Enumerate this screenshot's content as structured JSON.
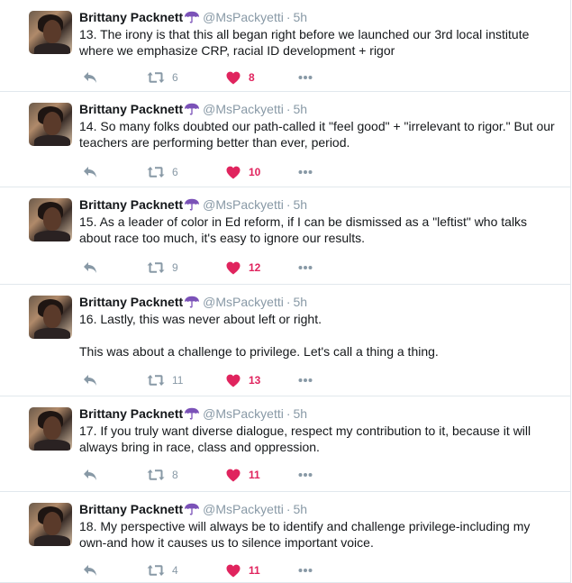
{
  "icons": {
    "reply": "reply-icon",
    "retweet": "retweet-icon",
    "like": "heart-icon",
    "more": "more-icon",
    "badge": "umbrella-icon"
  },
  "colors": {
    "name": "#14171a",
    "muted": "#8899a6",
    "like": "#e0245e",
    "umbrella": "#7b52b8",
    "divider": "#e1e8ed"
  },
  "tweets": [
    {
      "name": "Brittany Packnett",
      "handle": "@MsPackyetti",
      "separator": "·",
      "time": "5h",
      "paragraphs": [
        "13. The irony is that this all began right before we launched our 3rd local institute where we emphasize CRP, racial ID development + rigor"
      ],
      "retweets": "6",
      "likes": "8"
    },
    {
      "name": "Brittany Packnett",
      "handle": "@MsPackyetti",
      "separator": "·",
      "time": "5h",
      "paragraphs": [
        "14. So many folks doubted our path-called it \"feel good\" + \"irrelevant to rigor.\" But our teachers are performing better than ever, period."
      ],
      "retweets": "6",
      "likes": "10"
    },
    {
      "name": "Brittany Packnett",
      "handle": "@MsPackyetti",
      "separator": "·",
      "time": "5h",
      "paragraphs": [
        "15. As a leader of color in Ed reform, if I can be dismissed as a \"leftist\" who talks about race too much, it's easy to ignore our results."
      ],
      "retweets": "9",
      "likes": "12"
    },
    {
      "name": "Brittany Packnett",
      "handle": "@MsPackyetti",
      "separator": "·",
      "time": "5h",
      "paragraphs": [
        "16. Lastly, this was never about left or right.",
        "This was about a challenge to privilege. Let's call a thing a thing."
      ],
      "retweets": "11",
      "likes": "13"
    },
    {
      "name": "Brittany Packnett",
      "handle": "@MsPackyetti",
      "separator": "·",
      "time": "5h",
      "paragraphs": [
        "17. If you truly want diverse dialogue, respect my contribution to it, because it will always bring in race, class and oppression."
      ],
      "retweets": "8",
      "likes": "11"
    },
    {
      "name": "Brittany Packnett",
      "handle": "@MsPackyetti",
      "separator": "·",
      "time": "5h",
      "paragraphs": [
        "18. My perspective will always be to identify and challenge privilege-including my own-and how it causes us to silence important voice."
      ],
      "retweets": "4",
      "likes": "11"
    }
  ]
}
